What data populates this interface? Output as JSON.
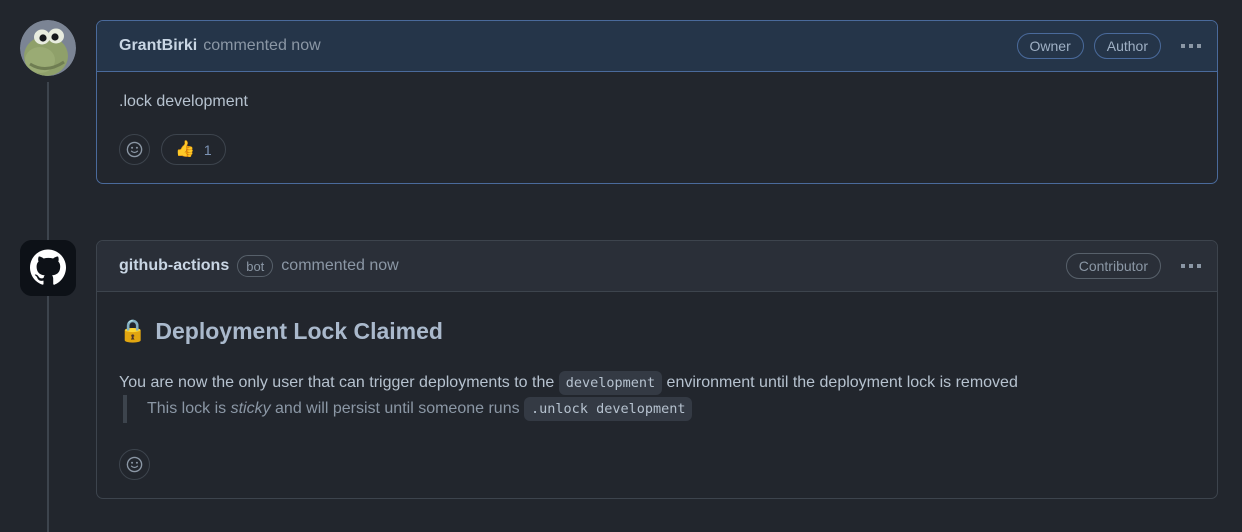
{
  "thread": {
    "comments": [
      {
        "id": "comment-grantbirki",
        "author": "GrantBirki",
        "meta": "commented now",
        "avatar_name": "avatar-grantbirki",
        "badges": [
          "Owner",
          "Author"
        ],
        "menu_icon": "kebab-menu-icon",
        "body_text": ".lock development",
        "reactions": {
          "add_label": "add-reaction",
          "items": [
            {
              "emoji": "👍",
              "name": "thumbs-up-reaction",
              "count": "1"
            }
          ]
        }
      },
      {
        "id": "comment-github-actions",
        "author": "github-actions",
        "bot_label": "bot",
        "meta": "commented now",
        "avatar_name": "avatar-github-actions",
        "badges": [
          "Contributor"
        ],
        "menu_icon": "kebab-menu-icon",
        "heading": {
          "emoji": "🔒",
          "emoji_name": "lock-emoji",
          "text": "Deployment Lock Claimed"
        },
        "paragraph": {
          "before": "You are now the only user that can trigger deployments to the",
          "code": "development",
          "after": "environment until the deployment lock is removed"
        },
        "blockquote": {
          "before": "This lock is",
          "italic": "sticky",
          "middle": "and will persist until someone runs",
          "code": ".unlock development"
        },
        "reactions": {
          "add_label": "add-reaction",
          "items": []
        }
      }
    ]
  },
  "colors": {
    "page_bg": "#22262d",
    "header_blue_bg": "#253549",
    "header_blue_border": "#4a6a9b",
    "header_grey_bg": "#2a2f38",
    "border_grey": "#3d444d",
    "text_primary": "#b6c2cf",
    "text_muted": "#8b97a5",
    "code_chip_bg": "#343a44",
    "lock_yellow": "#f5c542"
  }
}
